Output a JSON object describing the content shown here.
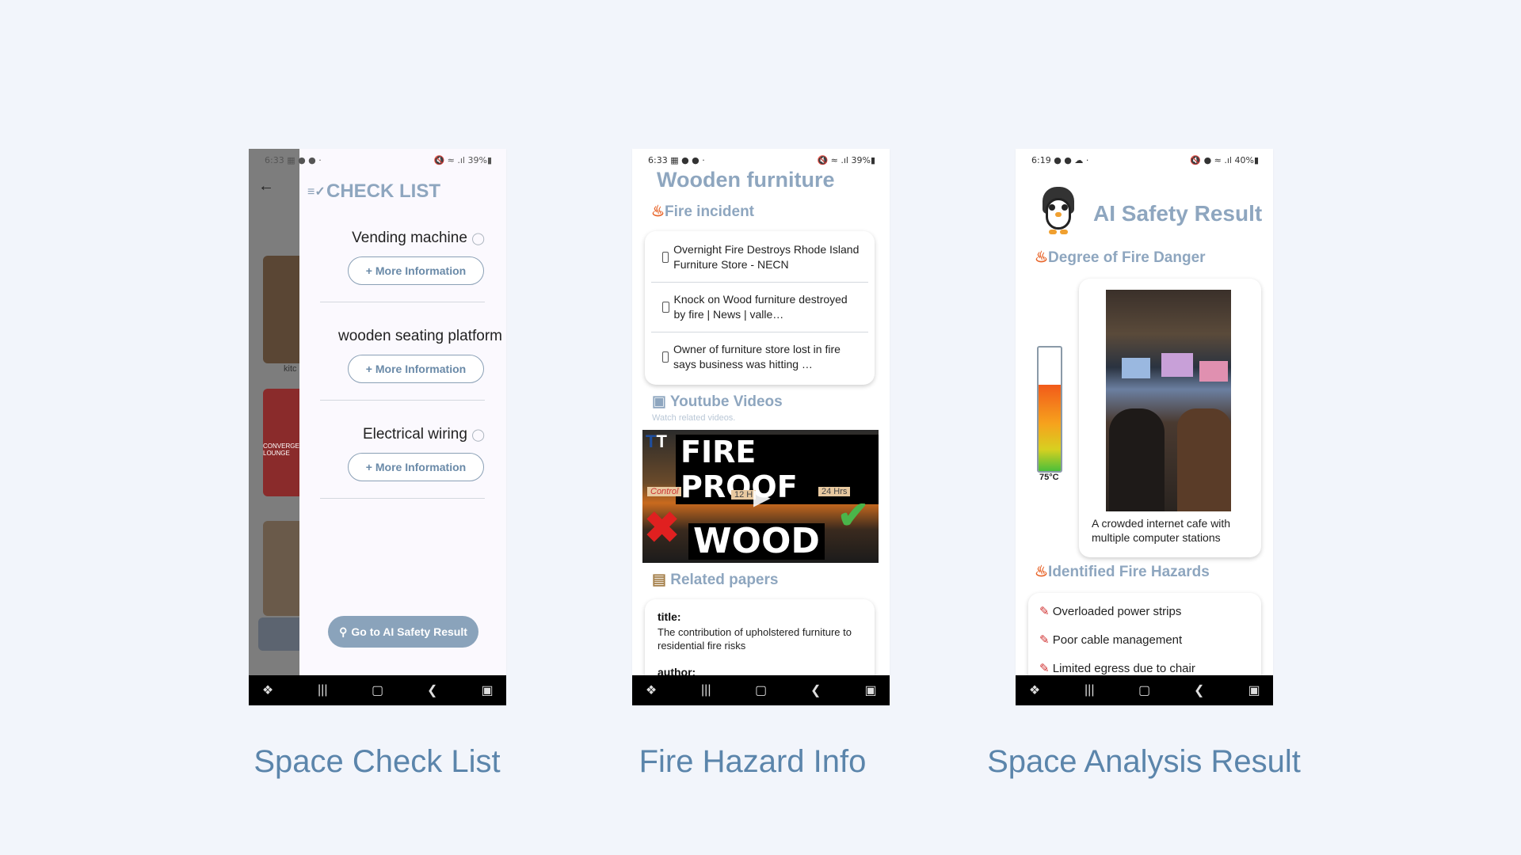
{
  "phone1": {
    "status_time": "6:33",
    "status_right": "39%",
    "title": "CHECK LIST",
    "items": [
      {
        "label": "Vending machine",
        "button": "More Information"
      },
      {
        "label": "wooden seating platform",
        "button": "More Information"
      },
      {
        "label": "Electrical wiring",
        "button": "More Information"
      }
    ],
    "bg_label": "kitc",
    "bg_sign": "CONVERGEN LOUNGE",
    "cta": "Go to AI Safety Result"
  },
  "phone2": {
    "status_time": "6:33",
    "status_right": "39%",
    "title": "Wooden furniture",
    "fire_section": "Fire incident",
    "news": [
      "Overnight Fire Destroys Rhode Island Furniture Store - NECN",
      "Knock on Wood furniture destroyed by fire | News | valle…",
      "Owner of furniture store lost in fire says business was hitting …"
    ],
    "youtube_section": "Youtube Videos",
    "youtube_sub": "Watch related videos.",
    "thumb_top": "FIRE PROOF",
    "thumb_bottom": "WOOD",
    "thumb_labels": [
      "Control",
      "12 H",
      "24 Hrs"
    ],
    "papers_section": "Related papers",
    "paper_title_label": "title:",
    "paper_title": "The contribution of upholstered furniture to residential fire risks",
    "paper_author_label": "author:"
  },
  "phone3": {
    "status_time": "6:19",
    "status_right": "40%",
    "title": "AI Safety Result",
    "danger_section": "Degree of Fire Danger",
    "temp": "75°C",
    "temp_fill": 0.7,
    "image_caption": "A crowded internet cafe with multiple computer stations",
    "hazards_section": "Identified Fire Hazards",
    "hazards": [
      "Overloaded power strips",
      "Poor cable management",
      "Limited egress due to chair"
    ]
  },
  "captions": {
    "c1": "Space Check List",
    "c2": "Fire Hazard Info",
    "c3": "Space Analysis Result"
  }
}
